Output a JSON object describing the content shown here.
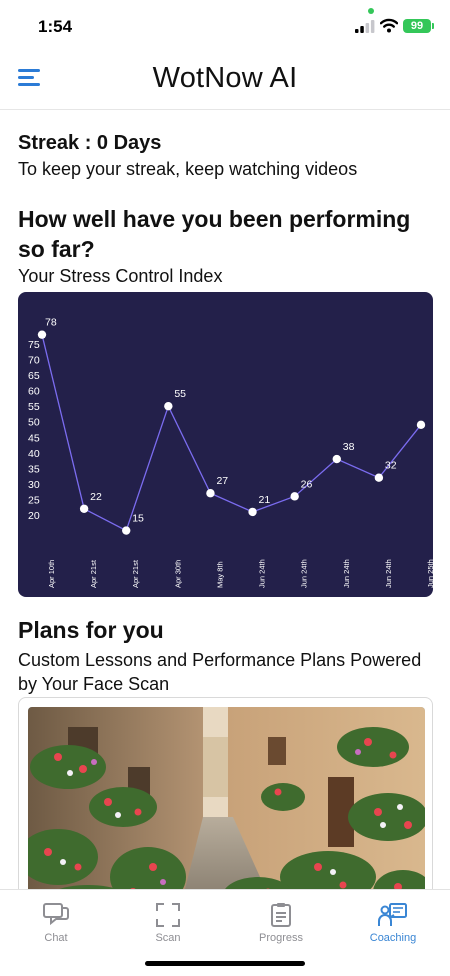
{
  "status": {
    "time": "1:54",
    "battery": "99"
  },
  "header": {
    "title": "WotNow AI"
  },
  "streak": {
    "title": "Streak : 0 Days",
    "subtitle": "To keep your streak, keep watching videos"
  },
  "performance": {
    "title": "How well have you been performing so far?",
    "subtitle": "Your Stress Control Index"
  },
  "chart_data": {
    "type": "line",
    "title": "",
    "xlabel": "",
    "ylabel": "",
    "x": [
      "Apr 10th",
      "Apr 21st",
      "Apr 21st",
      "Apr 30th",
      "May 8th",
      "Jun 24th",
      "Jun 24th",
      "Jun 24th",
      "Jun 24th",
      "Jun 25th"
    ],
    "values": [
      78,
      22,
      15,
      55,
      27,
      21,
      26,
      38,
      32,
      49
    ],
    "data_labels": [
      "78",
      "22",
      "15",
      "55",
      "27",
      "21",
      "26",
      "38",
      "32",
      ""
    ],
    "y_ticks": [
      20,
      25,
      30,
      35,
      40,
      45,
      50,
      55,
      60,
      65,
      70,
      75
    ],
    "ylim": [
      15,
      78
    ],
    "grid": false,
    "line_color": "#7b6cf0",
    "background": "#23204a"
  },
  "plans": {
    "title": "Plans for you",
    "subtitle": "Custom Lessons and Performance Plans Powered by Your Face Scan"
  },
  "tabs": [
    {
      "label": "Chat",
      "icon": "chat-icon",
      "active": false
    },
    {
      "label": "Scan",
      "icon": "scan-icon",
      "active": false
    },
    {
      "label": "Progress",
      "icon": "progress-icon",
      "active": false
    },
    {
      "label": "Coaching",
      "icon": "coaching-icon",
      "active": true
    }
  ],
  "colors": {
    "accent": "#3a86d4",
    "chart_bg": "#23204a",
    "battery": "#34c759"
  }
}
